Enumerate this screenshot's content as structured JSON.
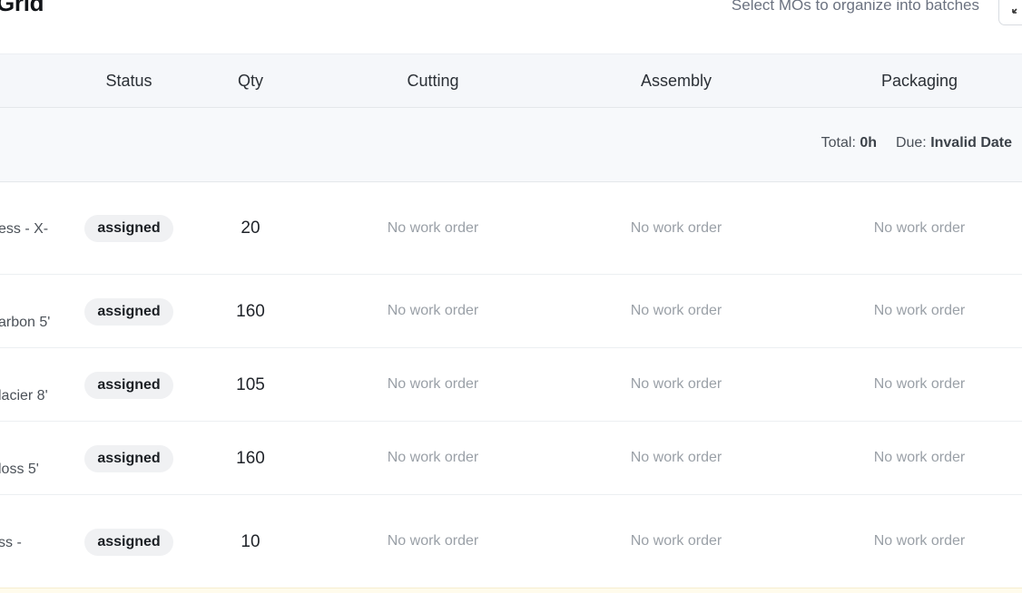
{
  "page": {
    "title": "Grid",
    "subtitle": "Select MOs to organize into batches"
  },
  "columns": {
    "status": "Status",
    "qty": "Qty",
    "cutting": "Cutting",
    "assembly": "Assembly",
    "packaging": "Packaging"
  },
  "summary": {
    "total_label": "Total:",
    "total_value": "0h",
    "due_label": "Due:",
    "due_value": "Invalid Date"
  },
  "rows": [
    {
      "name": "ess - X-",
      "status": "assigned",
      "qty": "20",
      "cutting": "No work order",
      "assembly": "No work order",
      "packaging": "No work order"
    },
    {
      "name": "arbon 5'",
      "status": "assigned",
      "qty": "160",
      "cutting": "No work order",
      "assembly": "No work order",
      "packaging": "No work order"
    },
    {
      "name": "lacier 8'",
      "status": "assigned",
      "qty": "105",
      "cutting": "No work order",
      "assembly": "No work order",
      "packaging": "No work order"
    },
    {
      "name": "loss 5'",
      "status": "assigned",
      "qty": "160",
      "cutting": "No work order",
      "assembly": "No work order",
      "packaging": "No work order"
    },
    {
      "name": "ss -",
      "status": "assigned",
      "qty": "10",
      "cutting": "No work order",
      "assembly": "No work order",
      "packaging": "No work order"
    }
  ],
  "icons": {
    "expand": "expand-icon"
  }
}
